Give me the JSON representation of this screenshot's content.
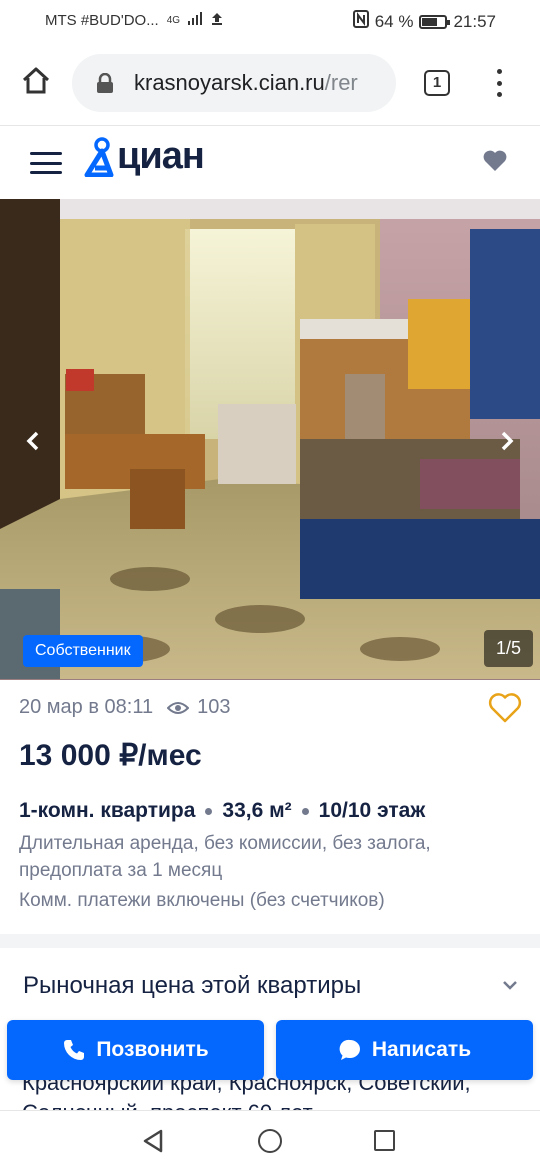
{
  "status_bar": {
    "carrier": "MTS #BUD'DO...",
    "network": "4G",
    "battery": "64 %",
    "battery_level": 0.64,
    "time": "21:57"
  },
  "browser": {
    "url_host": "krasnoyarsk.cian.ru",
    "url_path": "/rer",
    "tab_count": "1"
  },
  "site": {
    "logo": "циан"
  },
  "gallery": {
    "badge": "Собственник",
    "counter": "1/5"
  },
  "listing": {
    "date": "20 мар в 08:11",
    "views": "103",
    "price": "13 000 ₽/мес",
    "rooms": "1-комн. квартира",
    "area": "33,6 м²",
    "floor": "10/10 этаж",
    "terms": "Длительная аренда, без комиссии, без залога, предоплата за 1 месяц",
    "utilities": "Комм. платежи включены (без счетчиков)"
  },
  "market": {
    "title": "Рыночная цена этой квартиры"
  },
  "address": {
    "text": "Красноярский край, Красноярск, Советский, Солнечный, проспект 60 лет"
  },
  "actions": {
    "call": "Позвонить",
    "message": "Написать"
  },
  "colors": {
    "accent": "#0468ff",
    "text": "#152242",
    "muted": "#737a8e",
    "favorite": "#e8a318"
  }
}
